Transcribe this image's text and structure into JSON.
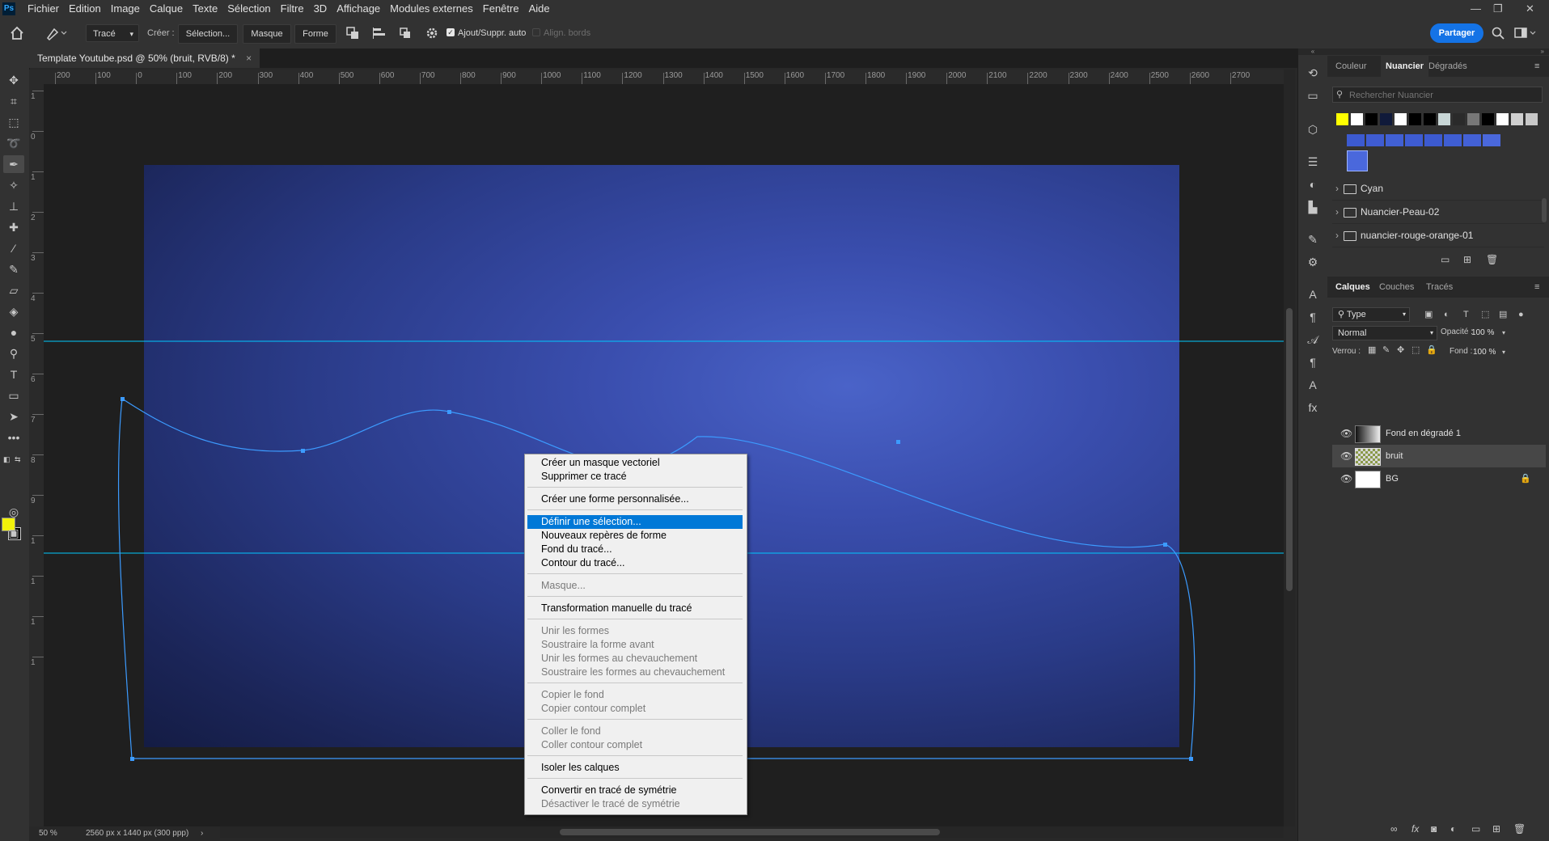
{
  "app": {
    "logo": "Ps"
  },
  "menu": [
    "Fichier",
    "Edition",
    "Image",
    "Calque",
    "Texte",
    "Sélection",
    "Filtre",
    "3D",
    "Affichage",
    "Modules externes",
    "Fenêtre",
    "Aide"
  ],
  "window_controls": {
    "minimize": "—",
    "restore": "❐",
    "close": "✕"
  },
  "options": {
    "tool_mode": "Tracé",
    "create_label": "Créer :",
    "selection_btn": "Sélection...",
    "mask_btn": "Masque",
    "shape_btn": "Forme",
    "auto_add_label": "Ajout/Suppr. auto",
    "align_edges_label": "Align. bords",
    "share_btn": "Partager"
  },
  "document": {
    "tab_title": "Template Youtube.psd @ 50% (bruit, RVB/8) *",
    "tab_close": "×",
    "zoom": "50 %",
    "doc_info": "2560 px x 1440 px (300 ppp)"
  },
  "rulers": {
    "h_ticks": [
      "200",
      "100",
      "0",
      "100",
      "200",
      "300",
      "400",
      "500",
      "600",
      "700",
      "800",
      "900",
      "1000",
      "1100",
      "1200",
      "1300",
      "1400",
      "1500",
      "1600",
      "1700",
      "1800",
      "1900",
      "2000",
      "2100",
      "2200",
      "2300",
      "2400",
      "2500",
      "2600",
      "2700"
    ],
    "v_ticks": [
      "1",
      "0",
      "1",
      "2",
      "3",
      "4",
      "5",
      "6",
      "7",
      "8",
      "9",
      "1",
      "1",
      "1",
      "1"
    ]
  },
  "context_menu": {
    "items": [
      {
        "label": "Créer un masque vectoriel",
        "state": "normal"
      },
      {
        "label": "Supprimer ce tracé",
        "state": "normal"
      },
      {
        "label": "Créer une forme personnalisée...",
        "state": "normal"
      },
      {
        "label": "Définir une sélection...",
        "state": "highlighted"
      },
      {
        "label": "Nouveaux repères de forme",
        "state": "normal"
      },
      {
        "label": "Fond du tracé...",
        "state": "normal"
      },
      {
        "label": "Contour du tracé...",
        "state": "normal"
      },
      {
        "label": "Masque...",
        "state": "disabled"
      },
      {
        "label": "Transformation manuelle du tracé",
        "state": "normal"
      },
      {
        "label": "Unir les formes",
        "state": "disabled"
      },
      {
        "label": "Soustraire la forme avant",
        "state": "disabled"
      },
      {
        "label": "Unir les formes au chevauchement",
        "state": "disabled"
      },
      {
        "label": "Soustraire les formes au chevauchement",
        "state": "disabled"
      },
      {
        "label": "Copier le fond",
        "state": "disabled"
      },
      {
        "label": "Copier contour complet",
        "state": "disabled"
      },
      {
        "label": "Coller le fond",
        "state": "disabled"
      },
      {
        "label": "Coller contour complet",
        "state": "disabled"
      },
      {
        "label": "Isoler les calques",
        "state": "normal"
      },
      {
        "label": "Convertir en tracé de symétrie",
        "state": "normal"
      },
      {
        "label": "Désactiver le tracé de symétrie",
        "state": "disabled"
      }
    ]
  },
  "swatches_panel": {
    "tabs": [
      "Couleur",
      "Nuancier",
      "Dégradés"
    ],
    "active_tab": "Nuancier",
    "search_placeholder": "Rechercher Nuancier",
    "row1_colors": [
      "#ffff00",
      "#ffffff",
      "#000000",
      "#101a3a",
      "#ffffff",
      "#000000",
      "#000000",
      "#c8d6d6",
      "#2a2a2a",
      "#777777",
      "#000000",
      "#ffffff",
      "#d0d0d0",
      "#c8c8c8"
    ],
    "row2_colors": [
      "#3c5ad0",
      "#3f5cd2",
      "#4160d4",
      "#3e5cd2",
      "#3c5ad0",
      "#3f5ed3",
      "#4361d6",
      "#4a68dc"
    ],
    "folders": [
      "Cyan",
      "Nuancier-Peau-02",
      "nuancier-rouge-orange-01"
    ]
  },
  "layers_panel": {
    "tabs": [
      "Calques",
      "Couches",
      "Tracés"
    ],
    "active_tab": "Calques",
    "filter": "Type",
    "blend_mode": "Normal",
    "opacity_label": "Opacité :",
    "opacity_value": "100 %",
    "lock_label": "Verrou :",
    "fill_label": "Fond :",
    "fill_value": "100 %",
    "layers": [
      {
        "name": "Fond en dégradé 1",
        "selected": false,
        "locked": false
      },
      {
        "name": "bruit",
        "selected": true,
        "locked": false
      },
      {
        "name": "BG",
        "selected": false,
        "locked": true
      }
    ]
  },
  "colors": {
    "foreground": "#f2f20a",
    "background": "#000000",
    "accent": "#1473e6",
    "guide": "#00c8ff",
    "path": "#3c9bff"
  }
}
